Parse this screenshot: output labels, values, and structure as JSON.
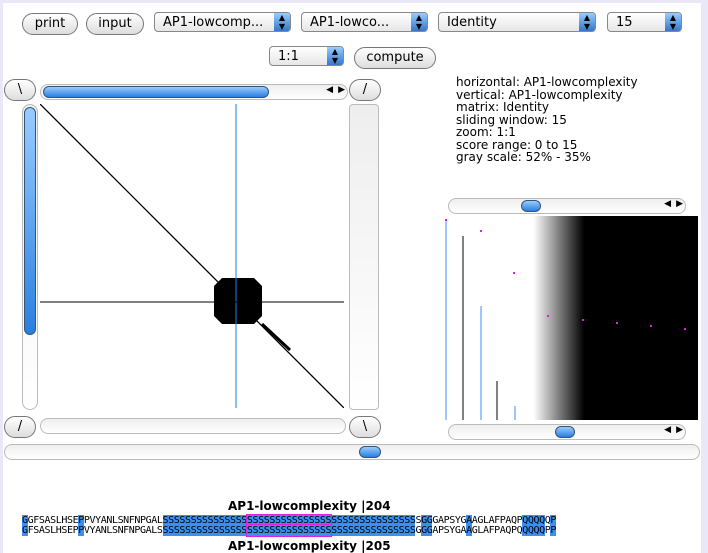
{
  "toolbar": {
    "print": "print",
    "input": "input",
    "horizontal_seq": "AP1-lowcomp...",
    "vertical_seq": "AP1-lowco...",
    "matrix": "Identity",
    "window": "15",
    "zoom": "1:1",
    "compute": "compute"
  },
  "nav": {
    "left_top": "\\",
    "right_top": "/",
    "left_bottom": "/",
    "right_bottom": "\\"
  },
  "info": {
    "horizontal": "horizontal: AP1-lowcomplexity",
    "vertical": "vertical: AP1-lowcomplexity",
    "matrix": "matrix: Identity",
    "window": "sliding window: 15",
    "zoom": "zoom: 1:1",
    "score": "score range: 0 to 15",
    "gray": "gray scale: 52% - 35%"
  },
  "alignment": {
    "top_label": "AP1-lowcomplexity",
    "top_pos": "204",
    "bottom_label": "AP1-lowcomplexity",
    "bottom_pos": "205",
    "line1": [
      {
        "t": "G",
        "h": 1
      },
      {
        "t": "GFSASLHSE",
        "h": 0
      },
      {
        "t": "P",
        "h": 1
      },
      {
        "t": "PVYANLSNFNPGAL",
        "h": 0
      },
      {
        "t": "SSSSSSSSSSSSSSS",
        "h": 1
      },
      {
        "t": "SSSSSSSSSSSSSSS",
        "h": 1,
        "b": 1
      },
      {
        "t": "SSSSSSSSSSSSSSS",
        "h": 1
      },
      {
        "t": "S",
        "h": 0
      },
      {
        "t": "GG",
        "h": 1
      },
      {
        "t": "GAPSYG",
        "h": 0
      },
      {
        "t": "A",
        "h": 1
      },
      {
        "t": "AGLAFPAQP",
        "h": 0
      },
      {
        "t": "QQQQ",
        "h": 1
      },
      {
        "t": "Q",
        "h": 0
      },
      {
        "t": "P",
        "h": 1
      }
    ],
    "line2": [
      {
        "t": "G",
        "h": 1
      },
      {
        "t": "FSASLHSEP",
        "h": 0
      },
      {
        "t": "P",
        "h": 1
      },
      {
        "t": "VYANLSNFNPGALS",
        "h": 0
      },
      {
        "t": "SSSSSSSSSSSSSSS",
        "h": 1
      },
      {
        "t": "SSSSSSSSSSSSSSS",
        "h": 1,
        "b": 1
      },
      {
        "t": "SSSSSSSSSSSSSSS",
        "h": 1
      },
      {
        "t": "G",
        "h": 0
      },
      {
        "t": "GG",
        "h": 1
      },
      {
        "t": "APSYGA",
        "h": 0
      },
      {
        "t": "A",
        "h": 1
      },
      {
        "t": "GLAFPAQPQ",
        "h": 0
      },
      {
        "t": "QQQQ",
        "h": 1
      },
      {
        "t": "P",
        "h": 0
      },
      {
        "t": "P",
        "h": 1
      }
    ]
  },
  "colors": {
    "highlight": "#3b8ff0",
    "crosshair": "#1e7fe8",
    "box": "#e020e0"
  }
}
